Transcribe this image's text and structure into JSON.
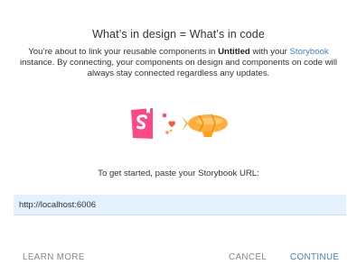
{
  "dialog": {
    "title": "What’s in design = What’s in code",
    "description": {
      "part1": "You’re about to link your reusable components in ",
      "file_name": "Untitled",
      "part2": " with your ",
      "link_text": "Storybook",
      "part3": " instance. By connecting, your components on design and components on code will always stay connected regardless any updates."
    },
    "illustration": {
      "left_icon": "storybook-logo-icon",
      "middle_icon": "heart-icon",
      "right_icon": "blimp-icon",
      "brand_color": "#ff4785",
      "heart_color": "#ff5a36",
      "blimp_color": "#ffae3d"
    },
    "prompt": "To get started, paste your Storybook URL:",
    "url_field": {
      "value": "http://localhost:6006"
    },
    "buttons": {
      "learn_more": "LEARN MORE",
      "cancel": "CANCEL",
      "continue": "CONTINUE"
    },
    "accent_color": "#3b82d6"
  }
}
